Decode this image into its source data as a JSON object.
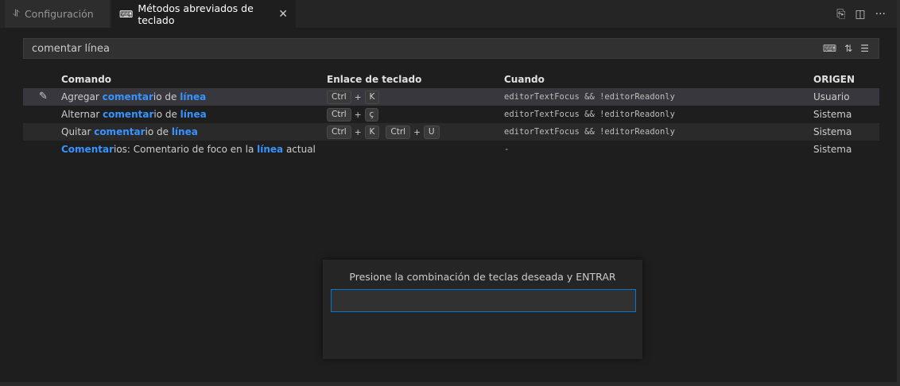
{
  "tabs": {
    "settings": {
      "icon": "settings-sliders-icon",
      "label": "Configuración"
    },
    "keybindings": {
      "icon": "keyboard-icon",
      "label": "Métodos abreviados de teclado"
    }
  },
  "search": {
    "value": "comentar línea"
  },
  "columns": {
    "command": "Comando",
    "keybinding": "Enlace de teclado",
    "when": "Cuando",
    "source": "ORIGEN"
  },
  "rows": [
    {
      "cmd_pre": "Agregar ",
      "cmd_hl1": "comentar",
      "cmd_mid": "io de ",
      "cmd_hl2": "línea",
      "cmd_post": "",
      "keys": [
        [
          "Ctrl",
          "K"
        ]
      ],
      "when": "editorTextFocus && !editorReadonly",
      "source": "Usuario"
    },
    {
      "cmd_pre": "Alternar ",
      "cmd_hl1": "comentar",
      "cmd_mid": "io de ",
      "cmd_hl2": "línea",
      "cmd_post": "",
      "keys": [
        [
          "Ctrl",
          "ç"
        ]
      ],
      "when": "editorTextFocus && !editorReadonly",
      "source": "Sistema"
    },
    {
      "cmd_pre": "Quitar ",
      "cmd_hl1": "comentar",
      "cmd_mid": "io de ",
      "cmd_hl2": "línea",
      "cmd_post": "",
      "keys": [
        [
          "Ctrl",
          "K"
        ],
        [
          "Ctrl",
          "U"
        ]
      ],
      "when": "editorTextFocus && !editorReadonly",
      "source": "Sistema"
    },
    {
      "cmd_pre": "",
      "cmd_hl1": "Comentar",
      "cmd_mid": "ios: Comentario de foco en la ",
      "cmd_hl2": "línea",
      "cmd_post": " actual",
      "keys": [],
      "when": "-",
      "source": "Sistema"
    }
  ],
  "dialog": {
    "message": "Presione la combinación de teclas deseada y ENTRAR",
    "value": ""
  },
  "colors": {
    "accent": "#3794ff",
    "focus_border": "#0078d4",
    "background": "#1e1e1e"
  }
}
